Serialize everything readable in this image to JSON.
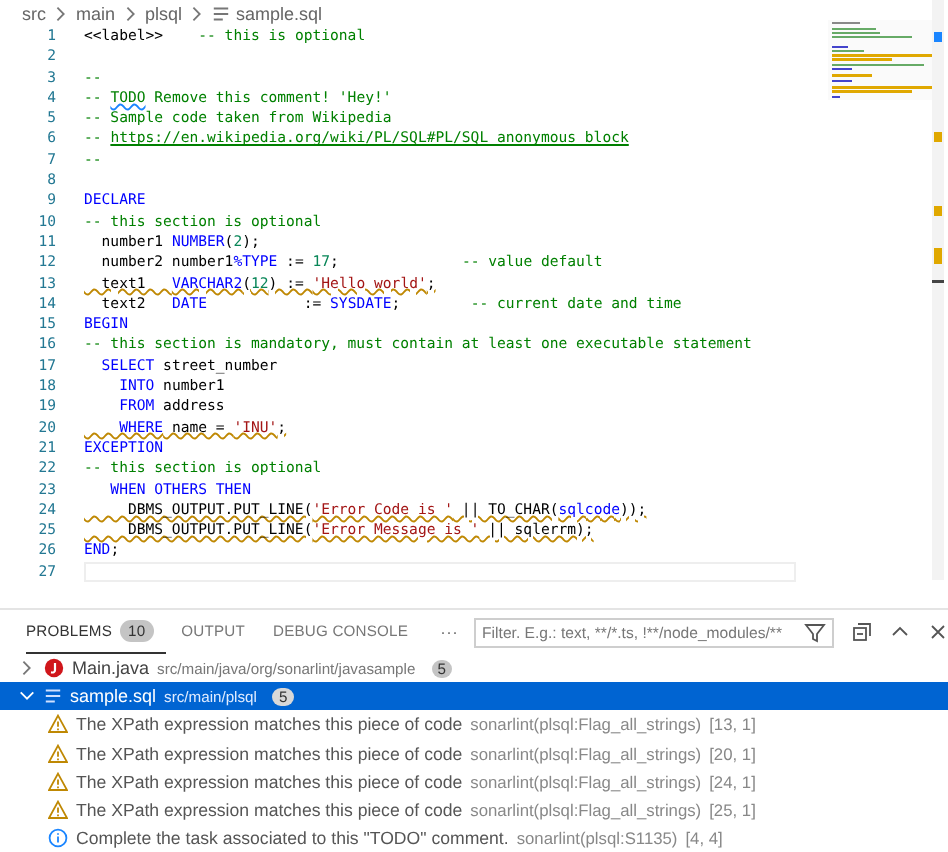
{
  "breadcrumb": [
    {
      "label": "src",
      "kind": "folder"
    },
    {
      "label": "main",
      "kind": "folder"
    },
    {
      "label": "plsql",
      "kind": "folder"
    },
    {
      "label": "sample.sql",
      "kind": "file"
    }
  ],
  "editor": {
    "lines": [
      {
        "number": "1",
        "warning": false,
        "current": false,
        "tokens": [
          {
            "text": "<<label>>    ",
            "kind": "plain"
          },
          {
            "text": "-- this is optional",
            "kind": "comment"
          }
        ]
      },
      {
        "number": "2",
        "warning": false,
        "current": false
      },
      {
        "number": "3",
        "warning": false,
        "current": false,
        "tokens": [
          {
            "text": "--",
            "kind": "comment"
          }
        ]
      },
      {
        "number": "4",
        "warning": false,
        "current": false,
        "tokens": [
          {
            "text": "-- ",
            "kind": "comment"
          },
          {
            "text": "TODO",
            "kind": "task"
          },
          {
            "text": " Remove this comment! 'Hey!'",
            "kind": "comment"
          }
        ]
      },
      {
        "number": "5",
        "warning": false,
        "current": false,
        "tokens": [
          {
            "text": "-- Sample code taken from Wikipedia",
            "kind": "comment"
          }
        ]
      },
      {
        "number": "6",
        "warning": false,
        "current": false,
        "tokens": [
          {
            "text": "-- ",
            "kind": "comment"
          },
          {
            "text": "https://en.wikipedia.org/wiki/PL/SQL#PL/SQL_anonymous_block",
            "kind": "link"
          }
        ]
      },
      {
        "number": "7",
        "warning": false,
        "current": false,
        "tokens": [
          {
            "text": "--",
            "kind": "comment"
          }
        ]
      },
      {
        "number": "8",
        "warning": false,
        "current": false
      },
      {
        "number": "9",
        "warning": false,
        "current": false,
        "tokens": [
          {
            "text": "DECLARE",
            "kind": "keyword"
          }
        ]
      },
      {
        "number": "10",
        "warning": false,
        "current": false,
        "tokens": [
          {
            "text": "-- this section is optional",
            "kind": "comment"
          }
        ]
      },
      {
        "number": "11",
        "warning": false,
        "current": false,
        "tokens": [
          {
            "text": "  number1 ",
            "kind": "plain"
          },
          {
            "text": "NUMBER",
            "kind": "keyword"
          },
          {
            "text": "(",
            "kind": "plain"
          },
          {
            "text": "2",
            "kind": "number"
          },
          {
            "text": ");",
            "kind": "plain"
          }
        ]
      },
      {
        "number": "12",
        "warning": false,
        "current": false,
        "tokens": [
          {
            "text": "  number2 number1",
            "kind": "plain"
          },
          {
            "text": "%TYPE",
            "kind": "keyword"
          },
          {
            "text": " := ",
            "kind": "plain"
          },
          {
            "text": "17",
            "kind": "number"
          },
          {
            "text": ";              ",
            "kind": "plain"
          },
          {
            "text": "-- value default",
            "kind": "comment"
          }
        ]
      },
      {
        "number": "13",
        "warning": true,
        "current": false,
        "tokens": [
          {
            "text": "  text1   ",
            "kind": "plain"
          },
          {
            "text": "VARCHAR2",
            "kind": "keyword"
          },
          {
            "text": "(",
            "kind": "plain"
          },
          {
            "text": "12",
            "kind": "number"
          },
          {
            "text": ") := ",
            "kind": "plain"
          },
          {
            "text": "'Hello world'",
            "kind": "string"
          },
          {
            "text": ";",
            "kind": "plain"
          }
        ]
      },
      {
        "number": "14",
        "warning": false,
        "current": false,
        "tokens": [
          {
            "text": "  text2   ",
            "kind": "plain"
          },
          {
            "text": "DATE",
            "kind": "keyword"
          },
          {
            "text": "           := ",
            "kind": "plain"
          },
          {
            "text": "SYSDATE",
            "kind": "keyword"
          },
          {
            "text": ";        ",
            "kind": "plain"
          },
          {
            "text": "-- current date and time",
            "kind": "comment"
          }
        ]
      },
      {
        "number": "15",
        "warning": false,
        "current": false,
        "tokens": [
          {
            "text": "BEGIN",
            "kind": "keyword"
          }
        ]
      },
      {
        "number": "16",
        "warning": false,
        "current": false,
        "tokens": [
          {
            "text": "-- this section is mandatory, must contain at least one executable statement",
            "kind": "comment"
          }
        ]
      },
      {
        "number": "17",
        "warning": false,
        "current": false,
        "tokens": [
          {
            "text": "  SELECT",
            "kind": "keyword"
          },
          {
            "text": " street_number",
            "kind": "plain"
          }
        ]
      },
      {
        "number": "18",
        "warning": false,
        "current": false,
        "tokens": [
          {
            "text": "    INTO",
            "kind": "keyword"
          },
          {
            "text": " number1",
            "kind": "plain"
          }
        ]
      },
      {
        "number": "19",
        "warning": false,
        "current": false,
        "tokens": [
          {
            "text": "    FROM",
            "kind": "keyword"
          },
          {
            "text": " address",
            "kind": "plain"
          }
        ]
      },
      {
        "number": "20",
        "warning": true,
        "current": false,
        "tokens": [
          {
            "text": "    WHERE",
            "kind": "keyword"
          },
          {
            "text": " name = ",
            "kind": "plain"
          },
          {
            "text": "'INU'",
            "kind": "string"
          },
          {
            "text": ";",
            "kind": "plain"
          }
        ]
      },
      {
        "number": "21",
        "warning": false,
        "current": false,
        "tokens": [
          {
            "text": "EXCEPTION",
            "kind": "keyword"
          }
        ]
      },
      {
        "number": "22",
        "warning": false,
        "current": false,
        "tokens": [
          {
            "text": "-- this section is optional",
            "kind": "comment"
          }
        ]
      },
      {
        "number": "23",
        "warning": false,
        "current": false,
        "tokens": [
          {
            "text": "   WHEN OTHERS THEN",
            "kind": "keyword"
          }
        ]
      },
      {
        "number": "24",
        "warning": true,
        "current": false,
        "tokens": [
          {
            "text": "     DBMS_OUTPUT.PUT_LINE(",
            "kind": "plain"
          },
          {
            "text": "'Error Code is '",
            "kind": "string"
          },
          {
            "text": " || TO_CHAR(",
            "kind": "plain"
          },
          {
            "text": "sqlcode",
            "kind": "keyword"
          },
          {
            "text": "));",
            "kind": "plain"
          }
        ]
      },
      {
        "number": "25",
        "warning": true,
        "current": false,
        "tokens": [
          {
            "text": "     DBMS_OUTPUT.PUT_LINE(",
            "kind": "plain"
          },
          {
            "text": "'Error Message is '",
            "kind": "string"
          },
          {
            "text": " || sqlerrm);",
            "kind": "plain"
          }
        ]
      },
      {
        "number": "26",
        "warning": false,
        "current": false,
        "tokens": [
          {
            "text": "END",
            "kind": "keyword"
          },
          {
            "text": ";",
            "kind": "plain"
          }
        ]
      },
      {
        "number": "27",
        "warning": false,
        "current": true
      }
    ]
  },
  "panel": {
    "tabs": [
      {
        "label": "PROBLEMS",
        "badge": "10",
        "selected": true
      },
      {
        "label": "OUTPUT",
        "selected": false
      },
      {
        "label": "DEBUG CONSOLE",
        "selected": false
      }
    ],
    "more": "···",
    "filter": {
      "placeholder": "Filter. E.g.: text, **/*.ts, !**/node_modules/**"
    },
    "groups": [
      {
        "kind": "java",
        "name": "Main.java",
        "path": "src/main/java/org/sonarlint/javasample",
        "count": "5",
        "expanded": false,
        "selected": false
      },
      {
        "kind": "file",
        "name": "sample.sql",
        "path": "src/main/plsql",
        "count": "5",
        "expanded": true,
        "selected": true,
        "children": [
          {
            "kind": "warning",
            "message": "The XPath expression matches this piece of code",
            "source": "sonarlint(plsql:Flag_all_strings)",
            "location": "[13, 1]"
          },
          {
            "kind": "warning",
            "message": "The XPath expression matches this piece of code",
            "source": "sonarlint(plsql:Flag_all_strings)",
            "location": "[20, 1]"
          },
          {
            "kind": "warning",
            "message": "The XPath expression matches this piece of code",
            "source": "sonarlint(plsql:Flag_all_strings)",
            "location": "[24, 1]"
          },
          {
            "kind": "warning",
            "message": "The XPath expression matches this piece of code",
            "source": "sonarlint(plsql:Flag_all_strings)",
            "location": "[25, 1]"
          },
          {
            "kind": "info",
            "message": "Complete the task associated to this \"TODO\" comment.",
            "source": "sonarlint(plsql:S1135)",
            "location": "[4, 4]"
          }
        ]
      }
    ]
  }
}
